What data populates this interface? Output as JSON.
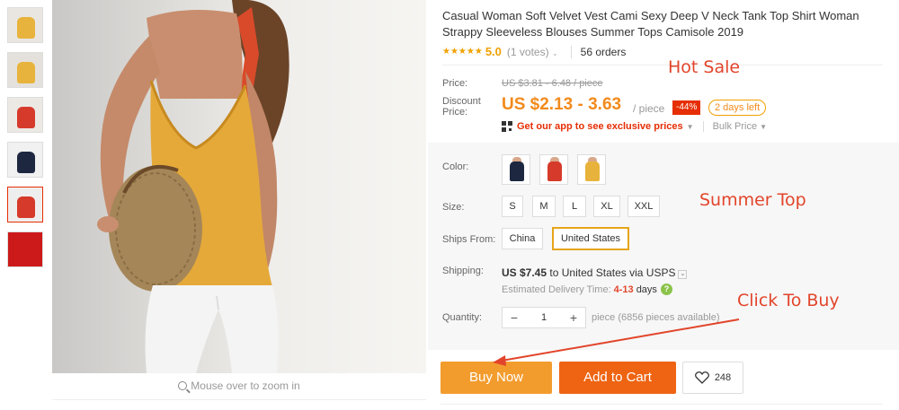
{
  "product": {
    "title": "Casual Woman Soft Velvet Vest Cami Sexy Deep V Neck Tank Top Shirt Woman Strappy Sleeveless Blouses Summer Tops Camisole 2019",
    "stars": "★★★★★",
    "rating": "5.0",
    "votes": "(1 votes)",
    "orders": "56 orders"
  },
  "gallery": {
    "zoom_hint": "Mouse over to zoom in",
    "thumbnails": [
      {
        "color": "#e8b33c"
      },
      {
        "color": "#e8b33c"
      },
      {
        "color": "#d63a2a"
      },
      {
        "color": "#1d2840"
      },
      {
        "color": "#d63a2a"
      },
      {
        "color": "#cc1a1a"
      }
    ]
  },
  "overlays": {
    "hot_sale": "Hot Sale",
    "summer_top": "Summer Top",
    "click_to_buy": "Click To Buy"
  },
  "price": {
    "price_label": "Price:",
    "original": "US $3.81 - 6.48 / piece",
    "discount_label": "Discount Price:",
    "current": "US $2.13 - 3.63",
    "per_piece": "/ piece",
    "discount_badge": "-44%",
    "days_left": "2 days left",
    "app_link": "Get our app to see exclusive prices",
    "bulk_price": "Bulk Price"
  },
  "options": {
    "color_label": "Color:",
    "colors": [
      "#1d2840",
      "#d63a2a",
      "#e8b33c"
    ],
    "size_label": "Size:",
    "sizes": [
      "S",
      "M",
      "L",
      "XL",
      "XXL"
    ],
    "ships_from_label": "Ships From:",
    "ships_from": [
      "China",
      "United States"
    ],
    "ships_from_selected": "United States"
  },
  "shipping": {
    "label": "Shipping:",
    "cost": "US $7.45",
    "to": "to United States via USPS",
    "est_label": "Estimated Delivery Time:",
    "est_days": "4-13",
    "est_unit": "days"
  },
  "quantity": {
    "label": "Quantity:",
    "minus": "−",
    "value": "1",
    "plus": "+",
    "available": "piece (6856 pieces available)"
  },
  "actions": {
    "buy_now": "Buy Now",
    "add_to_cart": "Add to Cart",
    "wishlist_count": "248"
  }
}
